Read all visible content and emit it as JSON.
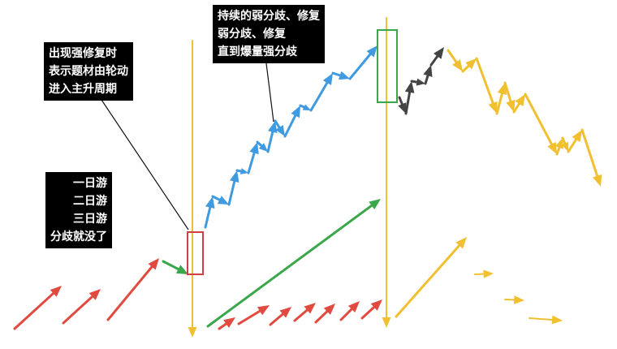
{
  "notes": {
    "divergence": {
      "lines": [
        "持续的弱分歧、修复",
        "弱分歧、修复",
        "直到爆量强分歧"
      ]
    },
    "strong_repair": {
      "lines": [
        "出现强修复时",
        "表示题材由轮动",
        "进入主升周期"
      ]
    },
    "short_trips": {
      "lines": [
        "一日游",
        "二日游",
        "三日游",
        "分歧就没了"
      ]
    }
  },
  "colors": {
    "phase_rotation": "#e04a3f",
    "phase_transition": "#3aa84a",
    "phase_main_rise": "#3f9ae0",
    "phase_peak": "#444444",
    "phase_decline": "#f0c030",
    "strong_repair_box": "#d04040",
    "peak_box": "#3aa84a"
  }
}
